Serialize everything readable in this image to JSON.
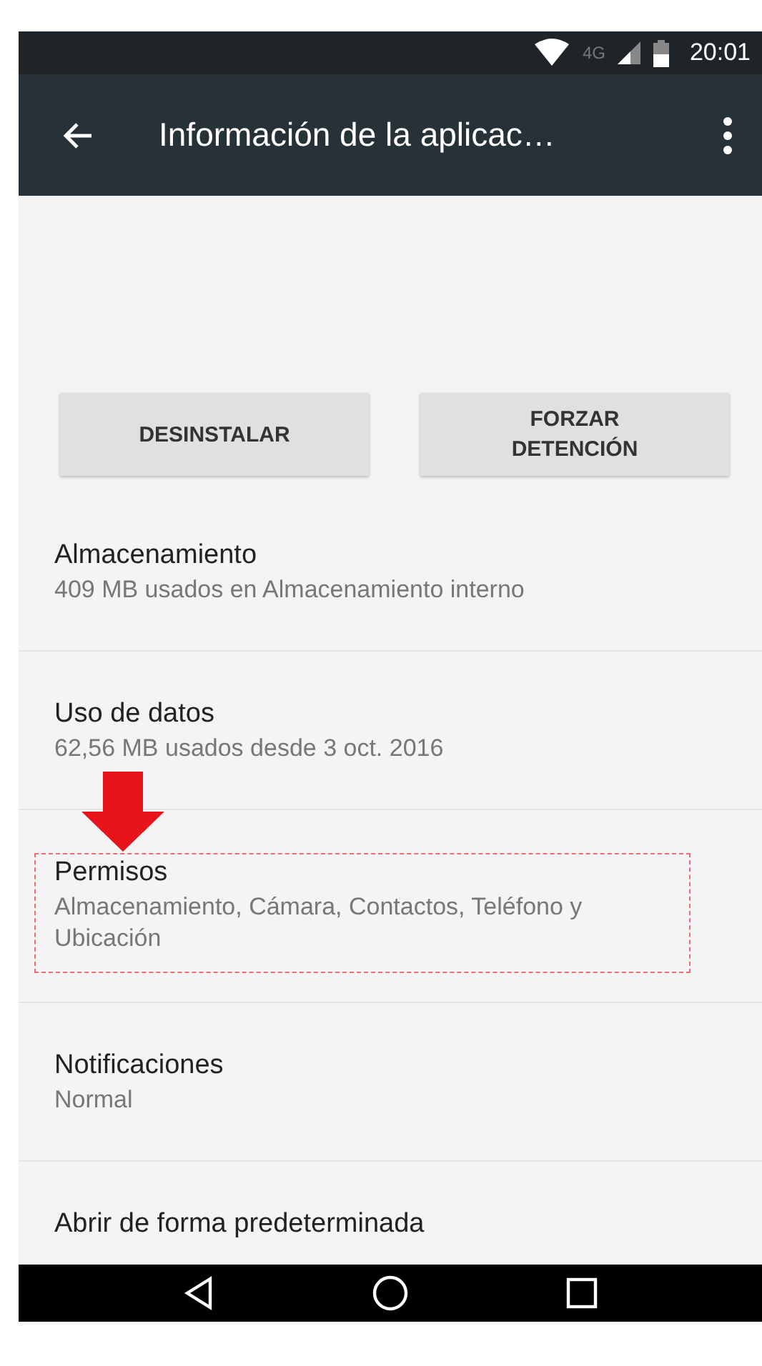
{
  "status_bar": {
    "network": "4G",
    "time": "20:01"
  },
  "app_bar": {
    "title": "Información de la aplicac…"
  },
  "buttons": [
    {
      "label": "DESINSTALAR"
    },
    {
      "label": "FORZAR DETENCIÓN"
    }
  ],
  "items": [
    {
      "title": "Almacenamiento",
      "subtitle": "409 MB usados en Almacenamiento interno",
      "highlighted": false
    },
    {
      "title": "Uso de datos",
      "subtitle": "62,56 MB usados desde 3 oct. 2016",
      "highlighted": false
    },
    {
      "title": "Permisos",
      "subtitle": "Almacenamiento, Cámara, Contactos, Teléfono y Ubicación",
      "highlighted": true
    },
    {
      "title": "Notificaciones",
      "subtitle": "Normal",
      "highlighted": false
    },
    {
      "title": "Abrir de forma predeterminada",
      "highlighted": false
    }
  ]
}
